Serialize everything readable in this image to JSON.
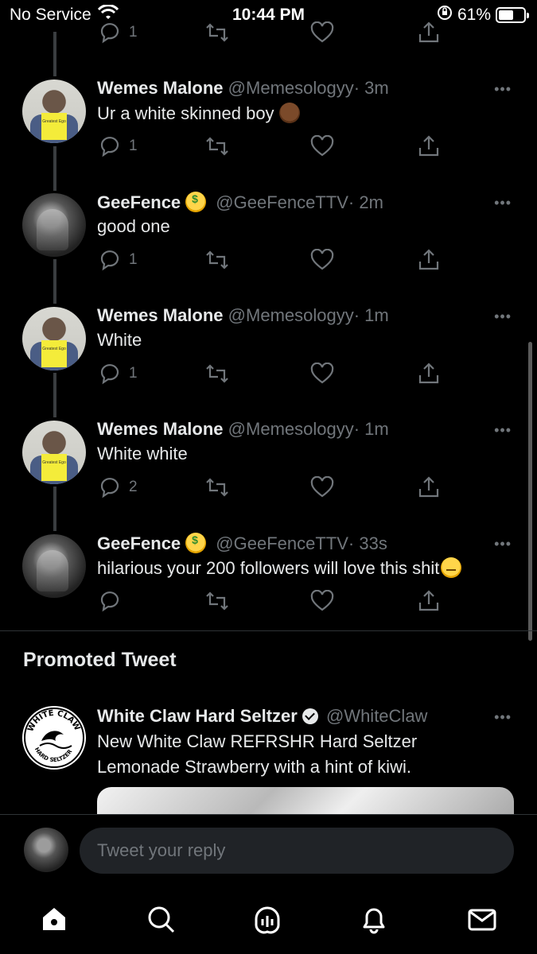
{
  "status_bar": {
    "carrier": "No Service",
    "time": "10:44 PM",
    "battery_percent": "61%",
    "battery_level": 0.61
  },
  "thread": [
    {
      "name": "Wemes Malone",
      "handle": "@Memesologyy",
      "time": "· 3m",
      "text": "Ur a white skinned boy",
      "emoji": "person-emoji",
      "replies": "1",
      "book_text": "Greatest Ego"
    },
    {
      "name": "GeeFence",
      "handle": "@GeeFenceTTV",
      "time": "· 2m",
      "text": "good one",
      "replies": "1"
    },
    {
      "name": "Wemes Malone",
      "handle": "@Memesologyy",
      "time": "· 1m",
      "text": "White",
      "replies": "1",
      "book_text": "Greatest Ego"
    },
    {
      "name": "Wemes Malone",
      "handle": "@Memesologyy",
      "time": "· 1m",
      "text": "White white",
      "replies": "2",
      "book_text": "Greatest Ego"
    },
    {
      "name": "GeeFence",
      "handle": "@GeeFenceTTV",
      "time": "· 33s",
      "text": "hilarious your 200 followers will love this shit",
      "replies": ""
    }
  ],
  "more_label": "•••",
  "promoted": {
    "section_title": "Promoted Tweet",
    "name": "White Claw Hard Seltzer",
    "handle": "@WhiteClaw",
    "text_line1": "New White Claw REFRSHR Hard Seltzer",
    "text_line2": "Lemonade Strawberry with a hint of kiwi.",
    "logo_text_top": "WHITE CLAW",
    "logo_text_bottom": "HARD SELTZER"
  },
  "reply": {
    "placeholder": "Tweet your reply"
  },
  "tabs": [
    "home-icon",
    "search-icon",
    "spaces-icon",
    "notifications-icon",
    "messages-icon"
  ],
  "colors": {
    "background": "#000000",
    "text": "#e7e9ea",
    "muted": "#71767b",
    "input_bg": "#202327"
  }
}
